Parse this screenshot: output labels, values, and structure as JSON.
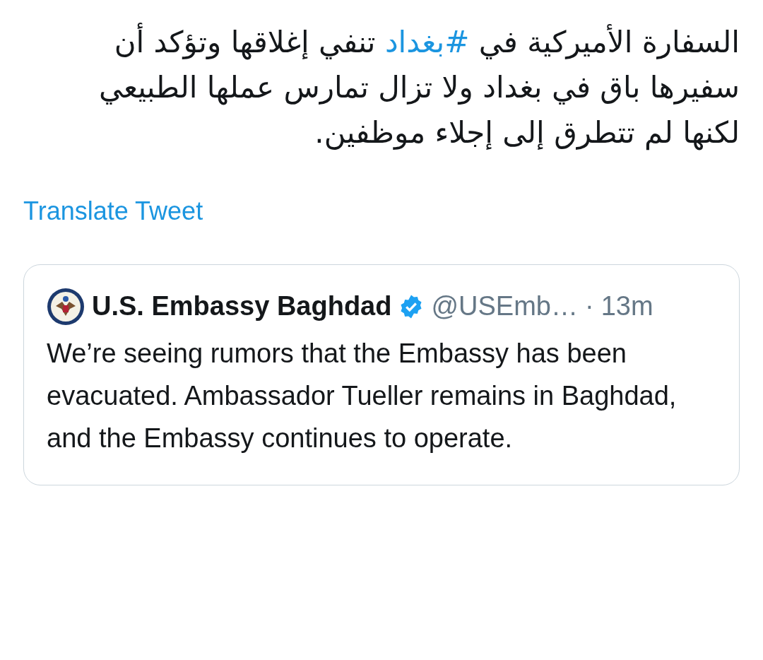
{
  "tweet": {
    "text_before": "السفارة الأميركية في ",
    "hashtag": "#بغداد",
    "text_after": " تنفي إغلاقها وتؤكد أن سفيرها باق في بغداد ولا تزال تمارس عملها الطبيعي لكنها لم تتطرق إلى إجلاء موظفين."
  },
  "translate_link": "Translate Tweet",
  "quoted_tweet": {
    "name": "U.S. Embassy Baghdad",
    "verified": true,
    "handle": "@USEmb…",
    "separator": "·",
    "time": "13m",
    "text": "We’re seeing rumors that the Embassy has been evacuated. Ambassador Tueller remains in Baghdad, and the Embassy continues to operate."
  }
}
